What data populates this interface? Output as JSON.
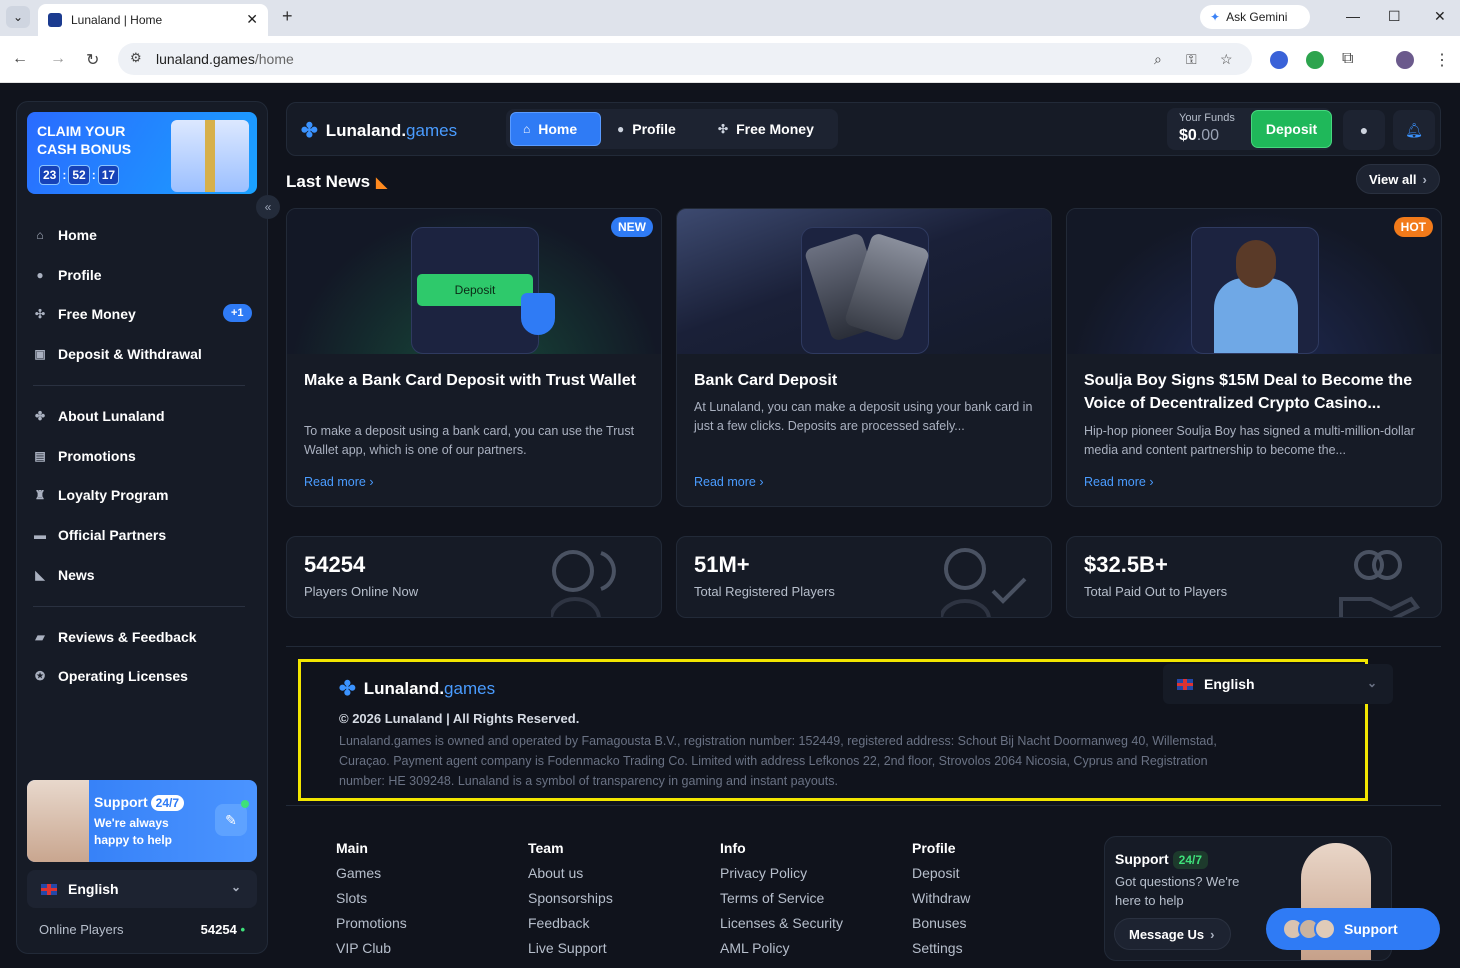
{
  "browser": {
    "tab_title": "Lunaland | Home",
    "url_host": "lunaland.games",
    "url_path": "/home",
    "gemini_label": "Ask Gemini"
  },
  "sidebar": {
    "promo": {
      "title": "CLAIM YOUR CASH BONUS",
      "timer": [
        "23",
        "52",
        "17"
      ]
    },
    "items": [
      {
        "label": "Home",
        "icon": "home-icon"
      },
      {
        "label": "Profile",
        "icon": "user-icon"
      },
      {
        "label": "Free Money",
        "icon": "free-money-icon",
        "badge": "+1"
      },
      {
        "label": "Deposit & Withdrawal",
        "icon": "wallet-icon"
      },
      {
        "label": "About Lunaland",
        "icon": "clover-icon"
      },
      {
        "label": "Promotions",
        "icon": "gift-icon"
      },
      {
        "label": "Loyalty Program",
        "icon": "trophy-icon"
      },
      {
        "label": "Official Partners",
        "icon": "briefcase-icon"
      },
      {
        "label": "News",
        "icon": "megaphone-icon"
      },
      {
        "label": "Reviews & Feedback",
        "icon": "chat-icon"
      },
      {
        "label": "Operating Licenses",
        "icon": "badge-icon"
      }
    ],
    "support": {
      "title": "Support",
      "badge": "24/7",
      "subtitle": "We're always happy to help"
    },
    "language": "English",
    "online_label": "Online Players",
    "online_value": "54254"
  },
  "header": {
    "brand_main": "Lunaland.",
    "brand_accent": "games",
    "nav": [
      {
        "label": "Home",
        "active": true
      },
      {
        "label": "Profile",
        "active": false
      },
      {
        "label": "Free Money",
        "active": false
      }
    ],
    "funds_label": "Your Funds",
    "funds_main": "$0",
    "funds_cents": ".00",
    "deposit_label": "Deposit"
  },
  "news": {
    "title": "Last News",
    "view_all": "View all",
    "cards": [
      {
        "tag": "NEW",
        "img_button": "Deposit",
        "title": "Make a Bank Card Deposit with Trust Wallet",
        "text": "To make a deposit using a bank card, you can use the Trust Wallet app, which is one of our partners.",
        "read_more": "Read more"
      },
      {
        "tag": "",
        "title": "Bank Card Deposit",
        "text": "At Lunaland, you can make a deposit using your bank card in just a few clicks. Deposits are processed safely...",
        "read_more": "Read more"
      },
      {
        "tag": "HOT",
        "title": "Soulja Boy Signs $15M Deal to Become the Voice of Decentralized Crypto Casino...",
        "text": "Hip-hop pioneer Soulja Boy has signed a multi-million-dollar media and content partnership to become the...",
        "read_more": "Read more"
      }
    ]
  },
  "stats": [
    {
      "value": "54254",
      "label": "Players Online Now"
    },
    {
      "value": "51M+",
      "label": "Total Registered Players"
    },
    {
      "value": "$32.5B+",
      "label": "Total Paid Out to Players"
    }
  ],
  "footer": {
    "brand_main": "Lunaland.",
    "brand_accent": "games",
    "language": "English",
    "copyright": "© 2026 Lunaland | All Rights Reserved.",
    "legal": "Lunaland.games is owned and operated by Famagousta B.V., registration number: 152449, registered address: Schout Bij Nacht Doormanweg 40, Willemstad, Curaçao. Payment agent company is Fodenmacko Trading Co. Limited with address Lefkonos 22, 2nd floor, Strovolos 2064 Nicosia, Cyprus and Registration number: HE 309248. Lunaland is a symbol of transparency in gaming and instant payouts.",
    "columns": [
      {
        "title": "Main",
        "items": [
          "Games",
          "Slots",
          "Promotions",
          "VIP Club"
        ]
      },
      {
        "title": "Team",
        "items": [
          "About us",
          "Sponsorships",
          "Feedback",
          "Live Support"
        ]
      },
      {
        "title": "Info",
        "items": [
          "Privacy Policy",
          "Terms of Service",
          "Licenses & Security",
          "AML Policy"
        ]
      },
      {
        "title": "Profile",
        "items": [
          "Deposit",
          "Withdraw",
          "Bonuses",
          "Settings"
        ]
      }
    ],
    "support": {
      "title": "Support",
      "badge": "24/7",
      "subtitle": "Got questions? We're here to help",
      "message_btn": "Message Us",
      "fab_label": "Support"
    }
  }
}
